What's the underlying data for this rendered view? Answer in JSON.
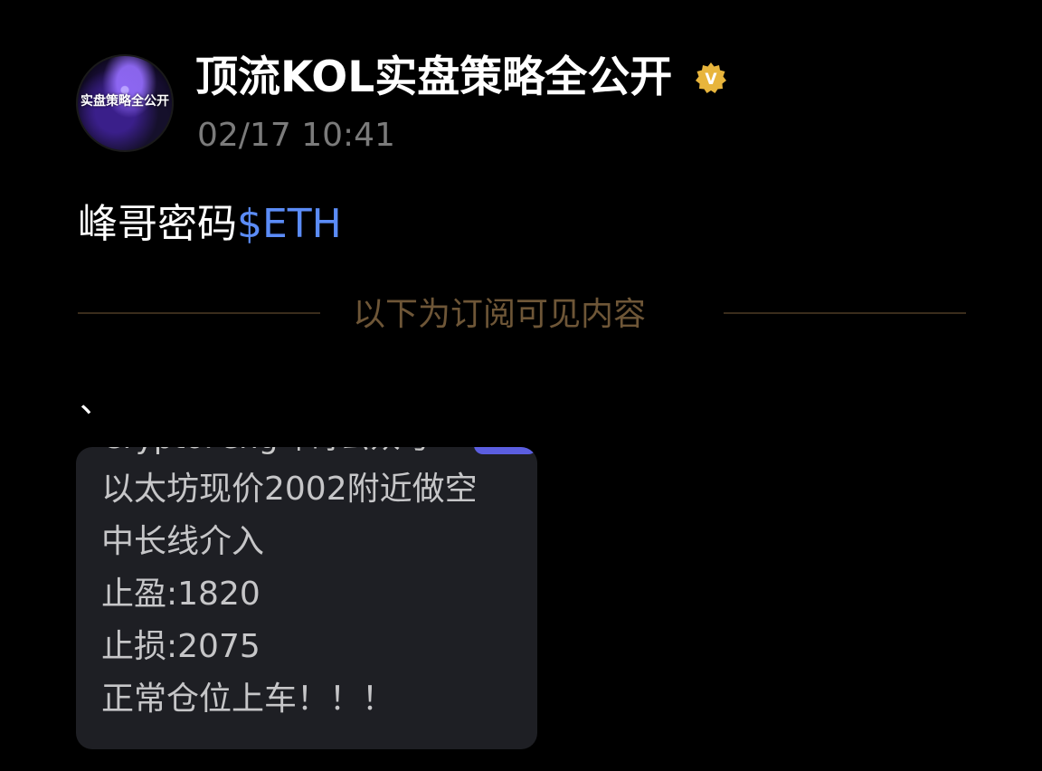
{
  "post": {
    "account_name": "顶流KOL实盘策略全公开",
    "avatar_text": "实盘策略全公开",
    "verified_badge_letter": "V",
    "time": "02/17 10:41",
    "text_prefix": "峰哥密码",
    "text_tag": "$ETH",
    "subscription_divider": "以下为订阅可见内容",
    "mark": "、"
  },
  "quote": {
    "cut_header": "CryptoFeng峰哥公众号",
    "lines": [
      "以太坊现价2002附近做空",
      "中长线介入",
      "止盈:1820",
      "止损:2075",
      "正常仓位上车！！！"
    ]
  },
  "colors": {
    "background": "#000000",
    "tag_blue": "#5b8cf7",
    "divider_gold": "#6e5637",
    "badge_gold": "#e8b53c",
    "card_bg": "#1e1f24"
  }
}
